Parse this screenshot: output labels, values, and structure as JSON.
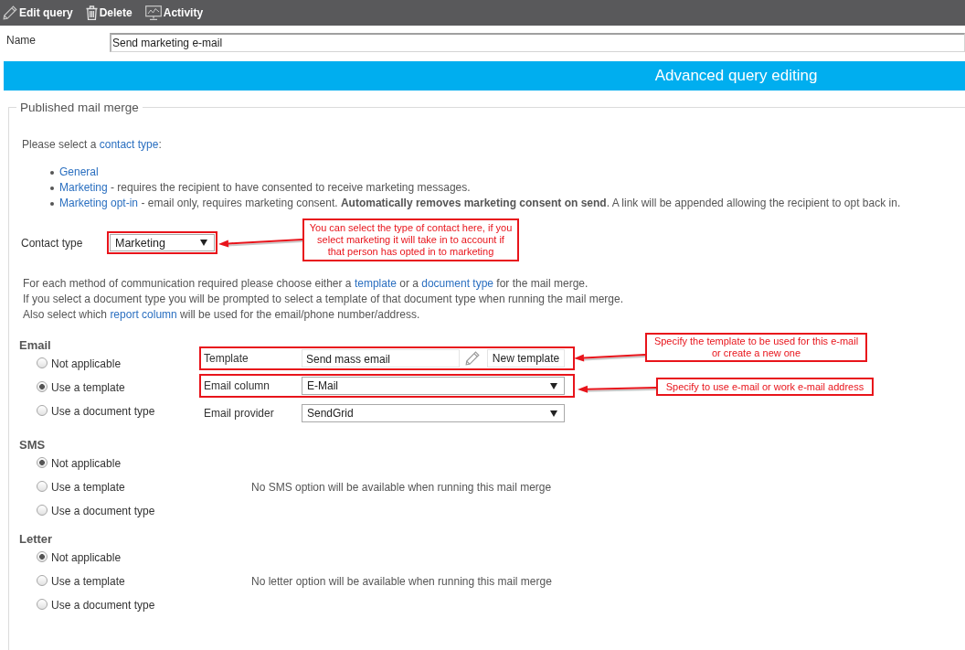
{
  "toolbar": {
    "items": [
      {
        "label": "Edit query"
      },
      {
        "label": "Delete"
      },
      {
        "label": "Activity"
      }
    ]
  },
  "name_field": {
    "label": "Name",
    "value": "Send marketing e-mail"
  },
  "banner": {
    "title": "Advanced query editing"
  },
  "section": {
    "legend": "Published mail merge",
    "intro": [
      {
        "kind": "text",
        "text": "Please select a "
      },
      {
        "kind": "link",
        "text": "contact type"
      },
      {
        "kind": "text",
        "text": ":"
      }
    ],
    "contact_types": [
      {
        "link": "General"
      },
      {
        "link": "Marketing",
        "text": " - requires the recipient to have consented to receive marketing messages."
      },
      {
        "link": "Marketing opt-in",
        "text": " - email only, requires marketing consent. **Automatically removes marketing consent on send**. A link will be appended allowing the recipient to opt back in."
      }
    ],
    "contact_type": {
      "label": "Contact type",
      "value": "Marketing",
      "highlighted": true
    },
    "instructions": [
      [
        {
          "kind": "text",
          "text": "For each method of communication required please choose either a "
        },
        {
          "kind": "link",
          "text": "template"
        },
        {
          "kind": "text",
          "text": " or a "
        },
        {
          "kind": "link",
          "text": "document type"
        },
        {
          "kind": "text",
          "text": " for the mail merge."
        }
      ],
      [
        {
          "kind": "text",
          "text": "If you select a document type you will be prompted to select a template of that document type when running the mail merge."
        }
      ],
      [
        {
          "kind": "text",
          "text": "Also select which "
        },
        {
          "kind": "link",
          "text": "report column"
        },
        {
          "kind": "text",
          "text": " will be used for the email/phone number/address."
        }
      ]
    ],
    "methods": [
      {
        "title": "Email",
        "options": [
          {
            "label": "Not applicable",
            "selected": false
          },
          {
            "label": "Use a template",
            "selected": true
          },
          {
            "label": "Use a document type",
            "selected": false
          }
        ],
        "settings": [
          {
            "kind": "template",
            "label": "Template",
            "value": "Send mass email",
            "button": "New template",
            "highlighted": true
          },
          {
            "kind": "select",
            "label": "Email column",
            "value": "E-Mail",
            "highlighted": true
          },
          {
            "kind": "select",
            "label": "Email provider",
            "value": "SendGrid",
            "highlighted": false
          }
        ]
      },
      {
        "title": "SMS",
        "options": [
          {
            "label": "Not applicable",
            "selected": true
          },
          {
            "label": "Use a template",
            "selected": false
          },
          {
            "label": "Use a document type",
            "selected": false
          }
        ],
        "message": "No SMS option will be available when running this mail merge"
      },
      {
        "title": "Letter",
        "options": [
          {
            "label": "Not applicable",
            "selected": true
          },
          {
            "label": "Use a template",
            "selected": false
          },
          {
            "label": "Use a document type",
            "selected": false
          }
        ],
        "message": "No letter option will be available when running this mail merge"
      }
    ]
  },
  "annotations": [
    {
      "text": "You can select the type of contact here, if you select marketing it will take in to account if that person has opted in to marketing"
    },
    {
      "text": "Specify the template to be used for this e-mail or create a new one"
    },
    {
      "text": "Specify to use e-mail or work e-mail address"
    }
  ]
}
